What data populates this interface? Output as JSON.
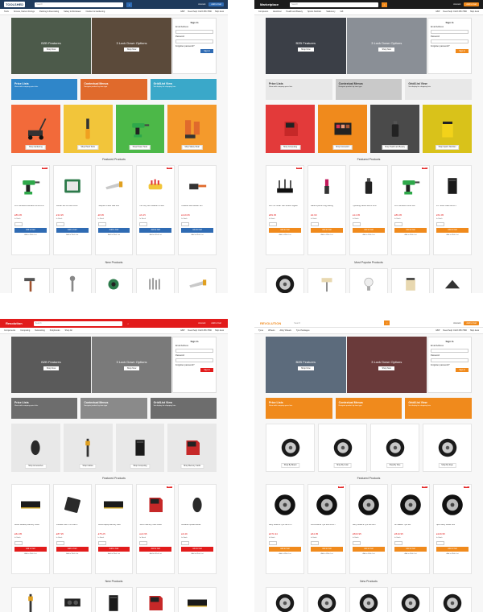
{
  "panels": [
    {
      "id": "p1",
      "logo": "TOOLSHED",
      "accent": "#2f6bb3",
      "topbar_bg": "#1e3a5c",
      "logo_bg": "#ffffff",
      "logo_color": "#1e3a5c",
      "search_placeholder": "Search",
      "account_label": "Account",
      "cart_label": "Add to Cart",
      "nav": [
        "Tools",
        "Screws, Nails & Fixings",
        "Painting & Decorating",
        "Safety & Workwear",
        "Outdoor & Gardening"
      ],
      "nav_right": [
        "GBP",
        "Need help: 0123 456 7890",
        "Help desk"
      ],
      "hero": [
        {
          "title": "B2B Features",
          "button": "Shop Now",
          "color": "#4c5a4a"
        },
        {
          "title": "3 Lock Down Options",
          "button": "Shop Now",
          "color": "#5b4a3a"
        }
      ],
      "login": {
        "title": "Sign In",
        "email": "Email Address",
        "password": "Password",
        "forgot": "Forgotten password?",
        "button": "Sign In"
      },
      "banners": [
        {
          "title": "Price Lists",
          "sub": "Show with company price lists",
          "bg": "#2f86c9",
          "fg": "#ffffff"
        },
        {
          "title": "Contextual Menus",
          "sub": "Navigate product by item type",
          "bg": "#e06a2c",
          "fg": "#ffffff"
        },
        {
          "title": "Grid/List View",
          "sub": "Set display for shopping lists",
          "bg": "#3aa8c9",
          "fg": "#ffffff"
        }
      ],
      "cats": [
        {
          "btn": "Shop Gardening",
          "bg": "#f26a3a",
          "icon": "lawnmower-icon"
        },
        {
          "btn": "Shop Hand Tools",
          "bg": "#f2c53a",
          "icon": "screwdriver-icon"
        },
        {
          "btn": "Shop Power Tools",
          "bg": "#4cb848",
          "icon": "drill-icon"
        },
        {
          "btn": "Shop Safety Wear",
          "bg": "#f49a2c",
          "icon": "boots-icon"
        }
      ],
      "featured_title": "Featured Products",
      "products": [
        {
          "name": "18V Cordless Brushless Combi Drill",
          "price": "£89.95",
          "icon": "drill-icon",
          "sale": "SALE"
        },
        {
          "name": "Socket Set 40 Piece Drive",
          "price": "£34.95",
          "icon": "case-icon",
          "sale": ""
        },
        {
          "name": "Hardpoint Panel Saw 22in",
          "price": "£8.95",
          "icon": "saw-icon",
          "sale": ""
        },
        {
          "name": "Hex Key Set Foldable 9 Piece",
          "price": "£6.45",
          "icon": "hexkey-icon",
          "sale": "SALE"
        },
        {
          "name": "Cordless Leaf Blower 18V",
          "price": "£119.95",
          "icon": "blower-icon",
          "sale": ""
        }
      ],
      "add_label": "Add to Cart",
      "stock_label": "In Stock",
      "wish_label": "Add to Wish List",
      "new_title": "New Products",
      "thumbs": [
        "hammer-icon",
        "wrench-icon",
        "grinder-icon",
        "tap-icon",
        "saw-icon"
      ]
    },
    {
      "id": "p2",
      "logo": "Marketplace",
      "accent": "#f08a1c",
      "topbar_bg": "#1c1c1c",
      "logo_bg": "#1c1c1c",
      "logo_color": "#ffffff",
      "search_placeholder": "Search",
      "account_label": "Account",
      "cart_label": "Add to Cart",
      "nav": [
        "Computers",
        "Electrical",
        "Health and Beauty",
        "Sports Nutrition",
        "Stationery",
        "Gift"
      ],
      "nav_right": [
        "GBP",
        "Need help: 0123 456 7890",
        "Help desk"
      ],
      "hero": [
        {
          "title": "B2B Features",
          "button": "Shop Now",
          "color": "#3b3f47"
        },
        {
          "title": "3 Lock Down Options",
          "button": "Shop Now",
          "color": "#8a8f96"
        }
      ],
      "login": {
        "title": "Sign In",
        "email": "Email Address",
        "password": "Password",
        "forgot": "Forgotten password?",
        "button": "Sign In"
      },
      "banners": [
        {
          "title": "Price Lists",
          "sub": "Show with company price lists",
          "bg": "#e8e8e8",
          "fg": "#333333"
        },
        {
          "title": "Contextual Menus",
          "sub": "Navigate product by item type",
          "bg": "#c9c9c9",
          "fg": "#333333"
        },
        {
          "title": "Grid/List View",
          "sub": "Set display for shopping lists",
          "bg": "#e8e8e8",
          "fg": "#333333"
        }
      ],
      "cats": [
        {
          "btn": "Shop Computing",
          "bg": "#e33a3a",
          "icon": "sdcard-icon"
        },
        {
          "btn": "Shop Cosmetics",
          "bg": "#f08a1c",
          "icon": "palette-icon"
        },
        {
          "btn": "Shop Health and Beauty",
          "bg": "#4a4a4a",
          "icon": "bottle-icon"
        },
        {
          "btn": "Shop Sports Nutrition",
          "bg": "#d9c21a",
          "icon": "tub-icon"
        }
      ],
      "featured_title": "Featured Products",
      "products": [
        {
          "name": "AC1750 Smart WiFi Router Gigabit",
          "price": "£89.95",
          "icon": "router-icon",
          "sale": "SALE"
        },
        {
          "name": "Matte Lipstick Long Lasting",
          "price": "£9.99",
          "icon": "lipstick-icon",
          "sale": ""
        },
        {
          "name": "Hydrating Facial Serum 30ml",
          "price": "£14.95",
          "icon": "bottle-icon",
          "sale": ""
        },
        {
          "name": "18V Cordless Combi Drill",
          "price": "£89.95",
          "icon": "drill-icon",
          "sale": "SALE"
        },
        {
          "name": "PC Tower Case Mid ATX",
          "price": "£54.95",
          "icon": "tower-icon",
          "sale": ""
        }
      ],
      "add_label": "Add to Cart",
      "stock_label": "In Stock",
      "wish_label": "Add to Wish List",
      "new_title": "Most Popular Products",
      "thumbs": [
        "wheel-icon",
        "roller-icon",
        "bulb-icon",
        "jar-icon",
        "pad-icon"
      ]
    },
    {
      "id": "p3",
      "logo": "Resolution",
      "accent": "#e21b1b",
      "topbar_bg": "#e21b1b",
      "logo_bg": "#e21b1b",
      "logo_color": "#ffffff",
      "search_placeholder": "Search",
      "account_label": "Account",
      "cart_label": "Add to Cart",
      "nav": [
        "Components",
        "Computing",
        "Networking",
        "Peripherals",
        "Shop All"
      ],
      "nav_right": [
        "GBP",
        "Need help: 0123 456 7890",
        "Help desk"
      ],
      "hero": [
        {
          "title": "B2B Features",
          "button": "Shop Now",
          "color": "#5a5a5a"
        },
        {
          "title": "3 Lock Down Options",
          "button": "Shop Now",
          "color": "#7a7a7a"
        }
      ],
      "login": {
        "title": "Sign In",
        "email": "Email Address",
        "password": "Password",
        "forgot": "Forgotten password?",
        "button": "Sign In"
      },
      "banners": [
        {
          "title": "Price Lists",
          "sub": "Show with company price lists",
          "bg": "#6d6d6d",
          "fg": "#ffffff"
        },
        {
          "title": "Contextual Menus",
          "sub": "Navigate product by item type",
          "bg": "#8a8a8a",
          "fg": "#ffffff"
        },
        {
          "title": "Grid/List View",
          "sub": "Set display for shopping lists",
          "bg": "#6d6d6d",
          "fg": "#ffffff"
        }
      ],
      "cats": [
        {
          "btn": "Shop Accessories",
          "bg": "#e8e8e8",
          "icon": "mouse-icon"
        },
        {
          "btn": "Shop Cables",
          "bg": "#e8e8e8",
          "icon": "cable-icon"
        },
        {
          "btn": "Shop Computing",
          "bg": "#e8e8e8",
          "icon": "tower-icon"
        },
        {
          "btn": "Shop Memory Cards",
          "bg": "#e8e8e8",
          "icon": "sdcard-icon"
        }
      ],
      "featured_title": "Featured Products",
      "products": [
        {
          "name": "DDR4 Desktop Memory 16GB",
          "price": "£64.95",
          "icon": "ram-icon",
          "sale": ""
        },
        {
          "name": "Portable SSD 1TB USB-C",
          "price": "£87.95",
          "icon": "ssd-icon",
          "sale": ""
        },
        {
          "name": "DDR4 Laptop Memory 8GB",
          "price": "£75.25",
          "icon": "ram-icon",
          "sale": ""
        },
        {
          "name": "SDXC Memory Card 64GB",
          "price": "£22.95",
          "icon": "sdcard-icon",
          "sale": "SALE"
        },
        {
          "name": "Wireless Optical Mouse",
          "price": "£9.49",
          "icon": "mouse-icon",
          "sale": ""
        }
      ],
      "add_label": "Add to Cart",
      "stock_label": "In Stock",
      "wish_label": "Add to Wish List",
      "new_title": "New Products",
      "thumbs": [
        "cable-icon",
        "gpu-icon",
        "tower-icon",
        "sdcard-icon",
        "ram-icon"
      ]
    },
    {
      "id": "p4",
      "logo": "REVOLUTION",
      "accent": "#f08a1c",
      "topbar_bg": "#ffffff",
      "logo_bg": "#ffffff",
      "logo_color": "#f08a1c",
      "search_placeholder": "Search",
      "account_label": "Account",
      "cart_label": "Add to Cart",
      "nav": [
        "Tyres",
        "Wheels",
        "Alloy Wheels",
        "Tyre Packages"
      ],
      "nav_right": [
        "GBP",
        "Need help: 0123 456 7890",
        "Help desk"
      ],
      "hero": [
        {
          "title": "B2B Features",
          "button": "Shop Now",
          "color": "#5c6b7c"
        },
        {
          "title": "3 Lock Down Options",
          "button": "Shop Now",
          "color": "#6a3a3a"
        }
      ],
      "login": {
        "title": "Sign In",
        "email": "Email Address",
        "password": "Password",
        "forgot": "Forgotten password?",
        "button": "Sign In"
      },
      "banners": [
        {
          "title": "Price Lists",
          "sub": "Show with company price lists",
          "bg": "#f08a1c",
          "fg": "#ffffff"
        },
        {
          "title": "Contextual Menus",
          "sub": "Navigate product by item type",
          "bg": "#f08a1c",
          "fg": "#ffffff"
        },
        {
          "title": "Grid/List View",
          "sub": "Set display for shopping lists",
          "bg": "#f08a1c",
          "fg": "#ffffff"
        }
      ],
      "cats": [
        {
          "btn": "Shop By Brand",
          "bg": "#ffffff",
          "icon": "wheel-icon"
        },
        {
          "btn": "Shop By Color",
          "bg": "#ffffff",
          "icon": "wheel-icon"
        },
        {
          "btn": "Shop By Size",
          "bg": "#ffffff",
          "icon": "wheel-icon"
        },
        {
          "btn": "Shop By Style",
          "bg": "#ffffff",
          "icon": "wheel-icon"
        }
      ],
      "featured_title": "Featured Products",
      "products": [
        {
          "name": "Alloy Wheel & Tyre Set 17in",
          "price": "£371.94",
          "icon": "tyre-icon",
          "sale": ""
        },
        {
          "name": "Performance Tyre 225/45 R17",
          "price": "£64.95",
          "icon": "tyre-icon",
          "sale": "SALE"
        },
        {
          "name": "Alloy Wheel & Tyre Set 18in",
          "price": "£503.95",
          "icon": "tyre-icon",
          "sale": ""
        },
        {
          "name": "All Season Tyre Set",
          "price": "£519.95",
          "icon": "tyre-icon",
          "sale": "SALE"
        },
        {
          "name": "Sport Alloy Wheel 19in",
          "price": "£249.95",
          "icon": "tyre-icon",
          "sale": "SALE"
        }
      ],
      "add_label": "Add to Cart",
      "stock_label": "In Stock",
      "wish_label": "Add to Wish List",
      "new_title": "New Products",
      "thumbs": [
        "wheel-icon",
        "wheel-icon",
        "wheel-icon",
        "wheel-icon",
        "wheel-icon"
      ]
    }
  ]
}
